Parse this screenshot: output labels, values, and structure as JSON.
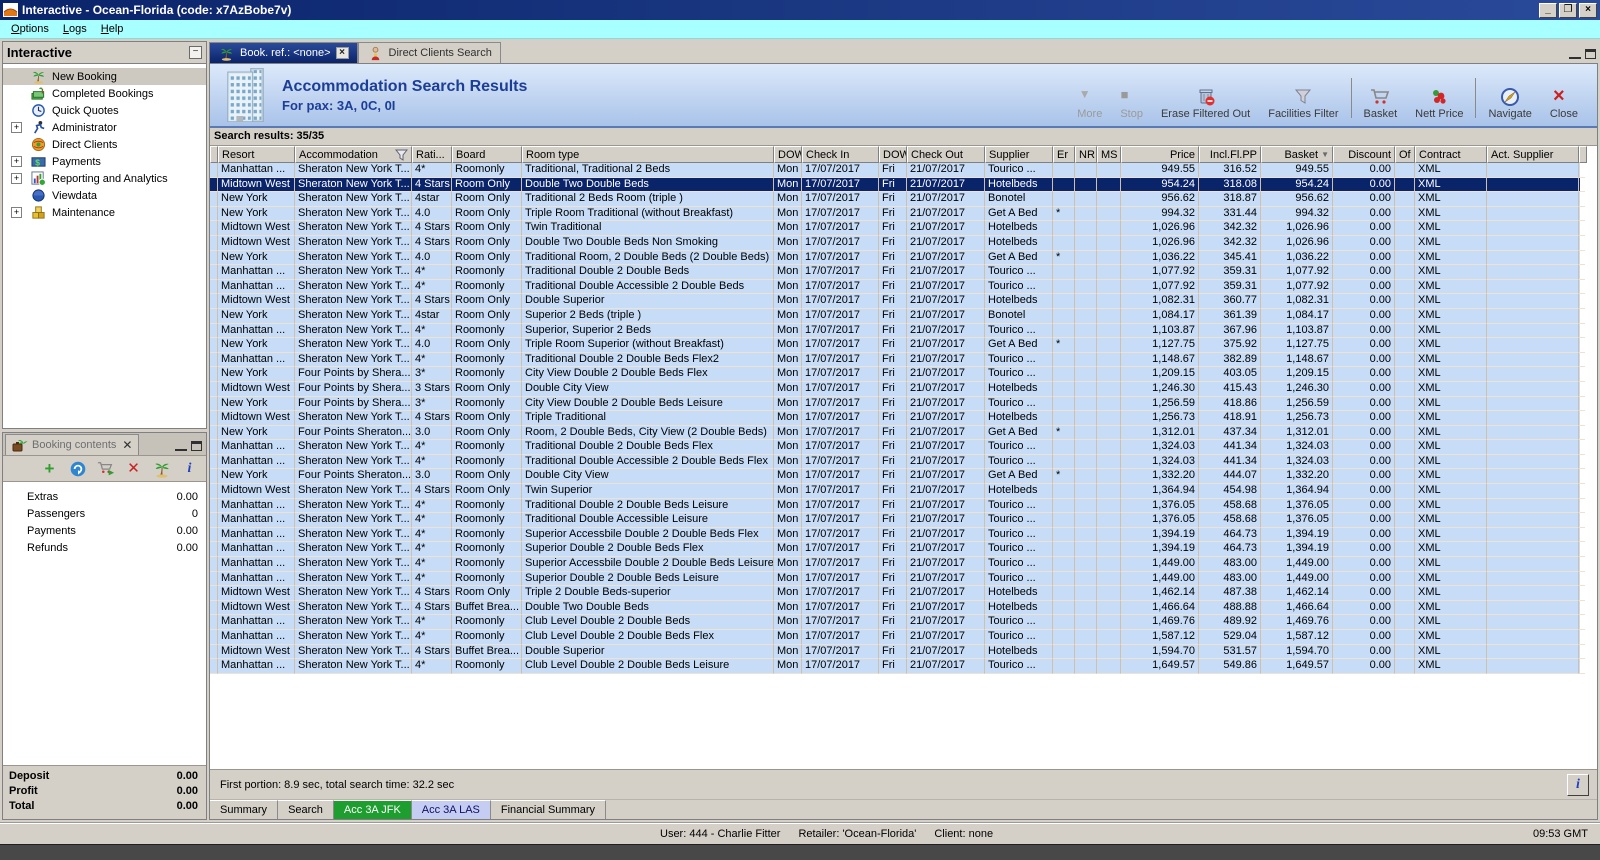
{
  "window": {
    "title": "Interactive - Ocean-Florida (code: x7AzBobe7v)",
    "controls": [
      "minimize",
      "restore",
      "close"
    ]
  },
  "menu": [
    "Options",
    "Logs",
    "Help"
  ],
  "sidebar": {
    "title": "Interactive",
    "items": [
      {
        "label": "New Booking",
        "icon": "palm-icon",
        "selected": true
      },
      {
        "label": "Completed Bookings",
        "icon": "completed-bookings-icon"
      },
      {
        "label": "Quick Quotes",
        "icon": "quick-quotes-icon"
      },
      {
        "label": "Administrator",
        "icon": "administrator-icon",
        "expandable": true
      },
      {
        "label": "Direct Clients",
        "icon": "direct-clients-icon"
      },
      {
        "label": "Payments",
        "icon": "payments-icon",
        "expandable": true
      },
      {
        "label": "Reporting and Analytics",
        "icon": "reporting-icon",
        "expandable": true
      },
      {
        "label": "Viewdata",
        "icon": "viewdata-icon"
      },
      {
        "label": "Maintenance",
        "icon": "maintenance-icon",
        "expandable": true
      }
    ]
  },
  "booking": {
    "tab_label": "Booking contents",
    "toolbar_icons": [
      "add-icon",
      "refresh-icon",
      "cart-add-icon",
      "delete-icon",
      "palm-icon",
      "info-icon"
    ],
    "rows": [
      {
        "label": "Extras",
        "value": "0.00"
      },
      {
        "label": "Passengers",
        "value": "0"
      },
      {
        "label": "Payments",
        "value": "0.00"
      },
      {
        "label": "Refunds",
        "value": "0.00"
      }
    ],
    "totals": [
      {
        "label": "Deposit",
        "value": "0.00"
      },
      {
        "label": "Profit",
        "value": "0.00"
      },
      {
        "label": "Total",
        "value": "0.00"
      }
    ]
  },
  "main_tabs": [
    {
      "label": "Book. ref.: <none>",
      "icon": "palm-icon",
      "active": true,
      "closable": true
    },
    {
      "label": "Direct Clients Search",
      "icon": "person-icon"
    }
  ],
  "header": {
    "title": "Accommodation Search Results",
    "subtitle": "For pax: 3A, 0C, 0I",
    "icon": "building-icon"
  },
  "toolbar": [
    {
      "label": "More",
      "icon": "more-arrow-icon",
      "disabled": true
    },
    {
      "label": "Stop",
      "icon": "stop-icon",
      "disabled": true
    },
    {
      "label": "Erase Filtered Out",
      "icon": "erase-filtered-icon"
    },
    {
      "label": "Facilities Filter",
      "icon": "facilities-filter-icon"
    },
    {
      "sep": true
    },
    {
      "label": "Basket",
      "icon": "basket-icon"
    },
    {
      "label": "Nett Price",
      "icon": "nett-price-icon"
    },
    {
      "sep": true
    },
    {
      "label": "Navigate",
      "icon": "navigate-icon"
    },
    {
      "label": "Close",
      "icon": "close-x-icon"
    }
  ],
  "results": {
    "summary": "Search results: 35/35",
    "selected_row": 1,
    "columns": [
      {
        "label": "Resort"
      },
      {
        "label": "Accommodation",
        "filter_icon": true
      },
      {
        "label": "Rati..."
      },
      {
        "label": "Board"
      },
      {
        "label": "Room type"
      },
      {
        "label": "DOW"
      },
      {
        "label": "Check In"
      },
      {
        "label": "DOW"
      },
      {
        "label": "Check Out"
      },
      {
        "label": "Supplier"
      },
      {
        "label": "Er"
      },
      {
        "label": "NR"
      },
      {
        "label": "MS"
      },
      {
        "label": "Price",
        "align": "right"
      },
      {
        "label": "Incl.Fl.PP",
        "align": "right"
      },
      {
        "label": "Basket",
        "align": "right",
        "sort": "desc"
      },
      {
        "label": "Discount",
        "align": "right"
      },
      {
        "label": "Of"
      },
      {
        "label": "Contract"
      },
      {
        "label": "Act. Supplier"
      }
    ],
    "rows": [
      [
        "Manhattan ...",
        "Sheraton New York T...",
        "4*",
        "Roomonly",
        "Traditional, Traditional 2 Beds",
        "Mon",
        "17/07/2017",
        "Fri",
        "21/07/2017",
        "Tourico ...",
        "",
        "",
        "",
        "949.55",
        "316.52",
        "949.55",
        "0.00",
        "",
        "XML",
        ""
      ],
      [
        "Midtown West",
        "Sheraton New York T...",
        "4 Stars",
        "Room Only",
        "Double Two Double Beds",
        "Mon",
        "17/07/2017",
        "Fri",
        "21/07/2017",
        "Hotelbeds",
        "",
        "",
        "",
        "954.24",
        "318.08",
        "954.24",
        "0.00",
        "",
        "XML",
        ""
      ],
      [
        "New York",
        "Sheraton New York T...",
        "4star",
        "Room Only",
        "Traditional 2 Beds Room (triple )",
        "Mon",
        "17/07/2017",
        "Fri",
        "21/07/2017",
        "Bonotel",
        "",
        "",
        "",
        "956.62",
        "318.87",
        "956.62",
        "0.00",
        "",
        "XML",
        ""
      ],
      [
        "New York",
        "Sheraton New York T...",
        "4.0",
        "Room Only",
        "Triple Room Traditional (without Breakfast)",
        "Mon",
        "17/07/2017",
        "Fri",
        "21/07/2017",
        "Get A Bed",
        "*",
        "",
        "",
        "994.32",
        "331.44",
        "994.32",
        "0.00",
        "",
        "XML",
        ""
      ],
      [
        "Midtown West",
        "Sheraton New York T...",
        "4 Stars",
        "Room Only",
        "Twin Traditional",
        "Mon",
        "17/07/2017",
        "Fri",
        "21/07/2017",
        "Hotelbeds",
        "",
        "",
        "",
        "1,026.96",
        "342.32",
        "1,026.96",
        "0.00",
        "",
        "XML",
        ""
      ],
      [
        "Midtown West",
        "Sheraton New York T...",
        "4 Stars",
        "Room Only",
        "Double Two Double Beds Non Smoking",
        "Mon",
        "17/07/2017",
        "Fri",
        "21/07/2017",
        "Hotelbeds",
        "",
        "",
        "",
        "1,026.96",
        "342.32",
        "1,026.96",
        "0.00",
        "",
        "XML",
        ""
      ],
      [
        "New York",
        "Sheraton New York T...",
        "4.0",
        "Room Only",
        "Traditional Room, 2 Double Beds (2 Double Beds)",
        "Mon",
        "17/07/2017",
        "Fri",
        "21/07/2017",
        "Get A Bed",
        "*",
        "",
        "",
        "1,036.22",
        "345.41",
        "1,036.22",
        "0.00",
        "",
        "XML",
        ""
      ],
      [
        "Manhattan ...",
        "Sheraton New York T...",
        "4*",
        "Roomonly",
        "Traditional Double 2 Double Beds",
        "Mon",
        "17/07/2017",
        "Fri",
        "21/07/2017",
        "Tourico ...",
        "",
        "",
        "",
        "1,077.92",
        "359.31",
        "1,077.92",
        "0.00",
        "",
        "XML",
        ""
      ],
      [
        "Manhattan ...",
        "Sheraton New York T...",
        "4*",
        "Roomonly",
        "Traditional Double Accessible  2 Double Beds",
        "Mon",
        "17/07/2017",
        "Fri",
        "21/07/2017",
        "Tourico ...",
        "",
        "",
        "",
        "1,077.92",
        "359.31",
        "1,077.92",
        "0.00",
        "",
        "XML",
        ""
      ],
      [
        "Midtown West",
        "Sheraton New York T...",
        "4 Stars",
        "Room Only",
        "Double Superior",
        "Mon",
        "17/07/2017",
        "Fri",
        "21/07/2017",
        "Hotelbeds",
        "",
        "",
        "",
        "1,082.31",
        "360.77",
        "1,082.31",
        "0.00",
        "",
        "XML",
        ""
      ],
      [
        "New York",
        "Sheraton New York T...",
        "4star",
        "Room Only",
        "Superior 2 Beds (triple )",
        "Mon",
        "17/07/2017",
        "Fri",
        "21/07/2017",
        "Bonotel",
        "",
        "",
        "",
        "1,084.17",
        "361.39",
        "1,084.17",
        "0.00",
        "",
        "XML",
        ""
      ],
      [
        "Manhattan ...",
        "Sheraton New York T...",
        "4*",
        "Roomonly",
        "Superior, Superior 2 Beds",
        "Mon",
        "17/07/2017",
        "Fri",
        "21/07/2017",
        "Tourico ...",
        "",
        "",
        "",
        "1,103.87",
        "367.96",
        "1,103.87",
        "0.00",
        "",
        "XML",
        ""
      ],
      [
        "New York",
        "Sheraton New York T...",
        "4.0",
        "Room Only",
        "Triple Room Superior (without Breakfast)",
        "Mon",
        "17/07/2017",
        "Fri",
        "21/07/2017",
        "Get A Bed",
        "*",
        "",
        "",
        "1,127.75",
        "375.92",
        "1,127.75",
        "0.00",
        "",
        "XML",
        ""
      ],
      [
        "Manhattan ...",
        "Sheraton New York T...",
        "4*",
        "Roomonly",
        "Traditional Double 2 Double Beds Flex2",
        "Mon",
        "17/07/2017",
        "Fri",
        "21/07/2017",
        "Tourico ...",
        "",
        "",
        "",
        "1,148.67",
        "382.89",
        "1,148.67",
        "0.00",
        "",
        "XML",
        ""
      ],
      [
        "New York",
        "Four Points by Shera...",
        "3*",
        "Roomonly",
        "City View Double 2 Double Beds Flex",
        "Mon",
        "17/07/2017",
        "Fri",
        "21/07/2017",
        "Tourico ...",
        "",
        "",
        "",
        "1,209.15",
        "403.05",
        "1,209.15",
        "0.00",
        "",
        "XML",
        ""
      ],
      [
        "Midtown West",
        "Four Points by Shera...",
        "3 Stars",
        "Room Only",
        "Double City View",
        "Mon",
        "17/07/2017",
        "Fri",
        "21/07/2017",
        "Hotelbeds",
        "",
        "",
        "",
        "1,246.30",
        "415.43",
        "1,246.30",
        "0.00",
        "",
        "XML",
        ""
      ],
      [
        "New York",
        "Four Points by Shera...",
        "3*",
        "Roomonly",
        "City View Double 2 Double Beds Leisure",
        "Mon",
        "17/07/2017",
        "Fri",
        "21/07/2017",
        "Tourico ...",
        "",
        "",
        "",
        "1,256.59",
        "418.86",
        "1,256.59",
        "0.00",
        "",
        "XML",
        ""
      ],
      [
        "Midtown West",
        "Sheraton New York T...",
        "4 Stars",
        "Room Only",
        "Triple Traditional",
        "Mon",
        "17/07/2017",
        "Fri",
        "21/07/2017",
        "Hotelbeds",
        "",
        "",
        "",
        "1,256.73",
        "418.91",
        "1,256.73",
        "0.00",
        "",
        "XML",
        ""
      ],
      [
        "New York",
        "Four Points Sheraton...",
        "3.0",
        "Room Only",
        "Room, 2 Double Beds, City View (2 Double Beds)",
        "Mon",
        "17/07/2017",
        "Fri",
        "21/07/2017",
        "Get A Bed",
        "*",
        "",
        "",
        "1,312.01",
        "437.34",
        "1,312.01",
        "0.00",
        "",
        "XML",
        ""
      ],
      [
        "Manhattan ...",
        "Sheraton New York T...",
        "4*",
        "Roomonly",
        "Traditional Double 2 Double Beds Flex",
        "Mon",
        "17/07/2017",
        "Fri",
        "21/07/2017",
        "Tourico ...",
        "",
        "",
        "",
        "1,324.03",
        "441.34",
        "1,324.03",
        "0.00",
        "",
        "XML",
        ""
      ],
      [
        "Manhattan ...",
        "Sheraton New York T...",
        "4*",
        "Roomonly",
        "Traditional Double Accessible  2 Double Beds Flex",
        "Mon",
        "17/07/2017",
        "Fri",
        "21/07/2017",
        "Tourico ...",
        "",
        "",
        "",
        "1,324.03",
        "441.34",
        "1,324.03",
        "0.00",
        "",
        "XML",
        ""
      ],
      [
        "New York",
        "Four Points Sheraton...",
        "3.0",
        "Room Only",
        "Double City View",
        "Mon",
        "17/07/2017",
        "Fri",
        "21/07/2017",
        "Get A Bed",
        "*",
        "",
        "",
        "1,332.20",
        "444.07",
        "1,332.20",
        "0.00",
        "",
        "XML",
        ""
      ],
      [
        "Midtown West",
        "Sheraton New York T...",
        "4 Stars",
        "Room Only",
        "Twin Superior",
        "Mon",
        "17/07/2017",
        "Fri",
        "21/07/2017",
        "Hotelbeds",
        "",
        "",
        "",
        "1,364.94",
        "454.98",
        "1,364.94",
        "0.00",
        "",
        "XML",
        ""
      ],
      [
        "Manhattan ...",
        "Sheraton New York T...",
        "4*",
        "Roomonly",
        "Traditional Double 2 Double Beds Leisure",
        "Mon",
        "17/07/2017",
        "Fri",
        "21/07/2017",
        "Tourico ...",
        "",
        "",
        "",
        "1,376.05",
        "458.68",
        "1,376.05",
        "0.00",
        "",
        "XML",
        ""
      ],
      [
        "Manhattan ...",
        "Sheraton New York T...",
        "4*",
        "Roomonly",
        "Traditional Double Accessible  Leisure",
        "Mon",
        "17/07/2017",
        "Fri",
        "21/07/2017",
        "Tourico ...",
        "",
        "",
        "",
        "1,376.05",
        "458.68",
        "1,376.05",
        "0.00",
        "",
        "XML",
        ""
      ],
      [
        "Manhattan ...",
        "Sheraton New York T...",
        "4*",
        "Roomonly",
        "Superior Accessbile Double 2 Double Beds Flex",
        "Mon",
        "17/07/2017",
        "Fri",
        "21/07/2017",
        "Tourico ...",
        "",
        "",
        "",
        "1,394.19",
        "464.73",
        "1,394.19",
        "0.00",
        "",
        "XML",
        ""
      ],
      [
        "Manhattan ...",
        "Sheraton New York T...",
        "4*",
        "Roomonly",
        "Superior Double 2 Double Beds Flex",
        "Mon",
        "17/07/2017",
        "Fri",
        "21/07/2017",
        "Tourico ...",
        "",
        "",
        "",
        "1,394.19",
        "464.73",
        "1,394.19",
        "0.00",
        "",
        "XML",
        ""
      ],
      [
        "Manhattan ...",
        "Sheraton New York T...",
        "4*",
        "Roomonly",
        "Superior Accessbile Double 2 Double Beds Leisure",
        "Mon",
        "17/07/2017",
        "Fri",
        "21/07/2017",
        "Tourico ...",
        "",
        "",
        "",
        "1,449.00",
        "483.00",
        "1,449.00",
        "0.00",
        "",
        "XML",
        ""
      ],
      [
        "Manhattan ...",
        "Sheraton New York T...",
        "4*",
        "Roomonly",
        "Superior Double 2 Double Beds Leisure",
        "Mon",
        "17/07/2017",
        "Fri",
        "21/07/2017",
        "Tourico ...",
        "",
        "",
        "",
        "1,449.00",
        "483.00",
        "1,449.00",
        "0.00",
        "",
        "XML",
        ""
      ],
      [
        "Midtown West",
        "Sheraton New York T...",
        "4 Stars",
        "Room Only",
        "Triple 2  Double Beds-superior",
        "Mon",
        "17/07/2017",
        "Fri",
        "21/07/2017",
        "Hotelbeds",
        "",
        "",
        "",
        "1,462.14",
        "487.38",
        "1,462.14",
        "0.00",
        "",
        "XML",
        ""
      ],
      [
        "Midtown West",
        "Sheraton New York T...",
        "4 Stars",
        "Buffet Brea...",
        "Double Two Double Beds",
        "Mon",
        "17/07/2017",
        "Fri",
        "21/07/2017",
        "Hotelbeds",
        "",
        "",
        "",
        "1,466.64",
        "488.88",
        "1,466.64",
        "0.00",
        "",
        "XML",
        ""
      ],
      [
        "Manhattan ...",
        "Sheraton New York T...",
        "4*",
        "Roomonly",
        "Club Level Double 2 Double Beds",
        "Mon",
        "17/07/2017",
        "Fri",
        "21/07/2017",
        "Tourico ...",
        "",
        "",
        "",
        "1,469.76",
        "489.92",
        "1,469.76",
        "0.00",
        "",
        "XML",
        ""
      ],
      [
        "Manhattan ...",
        "Sheraton New York T...",
        "4*",
        "Roomonly",
        "Club Level Double 2 Double Beds Flex",
        "Mon",
        "17/07/2017",
        "Fri",
        "21/07/2017",
        "Tourico ...",
        "",
        "",
        "",
        "1,587.12",
        "529.04",
        "1,587.12",
        "0.00",
        "",
        "XML",
        ""
      ],
      [
        "Midtown West",
        "Sheraton New York T...",
        "4 Stars",
        "Buffet Brea...",
        "Double Superior",
        "Mon",
        "17/07/2017",
        "Fri",
        "21/07/2017",
        "Hotelbeds",
        "",
        "",
        "",
        "1,594.70",
        "531.57",
        "1,594.70",
        "0.00",
        "",
        "XML",
        ""
      ],
      [
        "Manhattan ...",
        "Sheraton New York T...",
        "4*",
        "Roomonly",
        "Club Level Double 2 Double Beds Leisure",
        "Mon",
        "17/07/2017",
        "Fri",
        "21/07/2017",
        "Tourico ...",
        "",
        "",
        "",
        "1,649.57",
        "549.86",
        "1,649.57",
        "0.00",
        "",
        "XML",
        ""
      ]
    ]
  },
  "status": {
    "search_time": "First portion: 8.9 sec, total search time: 32.2 sec"
  },
  "bottom_tabs": [
    {
      "label": "Summary"
    },
    {
      "label": "Search"
    },
    {
      "label": "Acc 3A JFK",
      "highlight": "green"
    },
    {
      "label": "Acc 3A LAS",
      "highlight": "lavender"
    },
    {
      "label": "Financial Summary"
    }
  ],
  "statusbar": {
    "user": "User: 444 - Charlie Fitter",
    "retailer": "Retailer: 'Ocean-Florida'",
    "client": "Client: none",
    "time": "09:53 GMT"
  }
}
